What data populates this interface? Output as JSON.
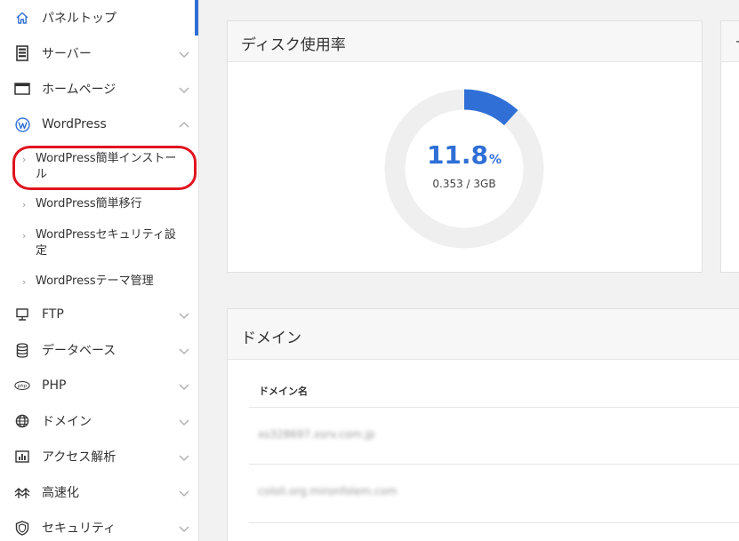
{
  "sidebar": {
    "items": [
      {
        "label": "パネルトップ",
        "icon": "home-icon",
        "top": 0
      },
      {
        "label": "サーバー",
        "icon": "server-icon"
      },
      {
        "label": "ホームページ",
        "icon": "browser-window-icon"
      },
      {
        "label": "WordPress",
        "icon": "wordpress-icon"
      },
      {
        "label": "FTP",
        "icon": "ftp-monitor-icon"
      },
      {
        "label": "データベース",
        "icon": "database-icon"
      },
      {
        "label": "PHP",
        "icon": "php-icon"
      },
      {
        "label": "ドメイン",
        "icon": "globe-icon"
      },
      {
        "label": "アクセス解析",
        "icon": "bar-chart-icon"
      },
      {
        "label": "高速化",
        "icon": "speed-icon"
      },
      {
        "label": "セキュリティ",
        "icon": "shield-icon"
      }
    ],
    "wordpress_sub": [
      {
        "label": "WordPress簡単インストール"
      },
      {
        "label": "WordPress簡単移行"
      },
      {
        "label": "WordPressセキュリティ設定"
      },
      {
        "label": "WordPressテーマ管理"
      }
    ]
  },
  "disk_card": {
    "title": "ディスク使用率",
    "percent": "11.8",
    "percent_unit": "%",
    "percent_value": 11.8,
    "usage": "0.353 / 3GB"
  },
  "side_card": {
    "title_fragment": "サ"
  },
  "domain_card": {
    "title": "ドメイン",
    "column_header": "ドメイン名",
    "rows": [
      {
        "name": "xs328697.xsrv.com.jp"
      },
      {
        "name": "cololi.org.mironfolem.com"
      }
    ]
  },
  "colors": {
    "accent": "#2f6fd6",
    "track": "#efefef",
    "highlight": "#e0141e"
  }
}
